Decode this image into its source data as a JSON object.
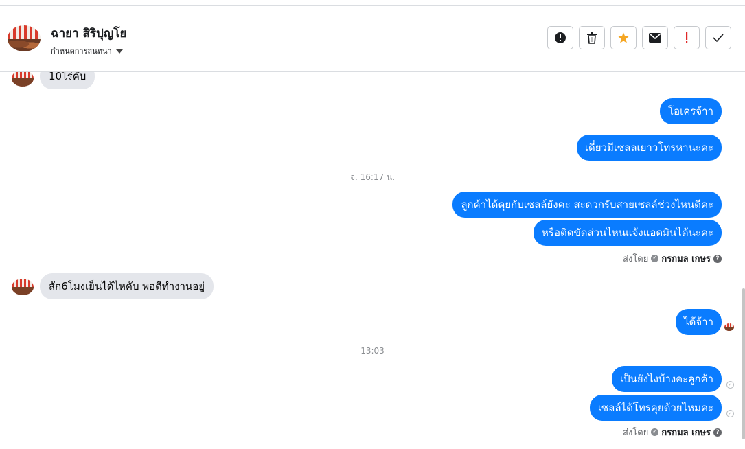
{
  "header": {
    "contact_name": "ฉายา สิริปุญโย",
    "conversation_settings": "กำหนดการสนทนา"
  },
  "toolbar": {
    "buttons": [
      {
        "icon": "alert-circle-icon",
        "label": "Info"
      },
      {
        "icon": "trash-icon",
        "label": "Delete"
      },
      {
        "icon": "star-icon",
        "label": "Star",
        "color": "#f5a623"
      },
      {
        "icon": "envelope-icon",
        "label": "Mark unread"
      },
      {
        "icon": "exclamation-icon",
        "label": "Spam",
        "color": "#e02828"
      },
      {
        "icon": "checkmark-icon",
        "label": "Done"
      }
    ]
  },
  "messages": {
    "m1_in": "10ไร่คับ",
    "m2_out": "โอเครจ้าา",
    "m3_out": "เดี๋ยวมีเซลลเยาวโทรหานะคะ",
    "ts1": "จ. 16:17 น.",
    "m4_out": "ลูกค้าได้คุยกับเซลล์ยังคะ สะดวกรับสายเซลล์ช่วงไหนดีคะ",
    "m5_out": "หรือติดขัดส่วนไหนแจ้งแอดมินได้นะคะ",
    "sent_by_label": "ส่งโดย",
    "sent_by_name": "กรกมล เกษร",
    "m6_in": "สัก6โมงเย็นได้ไหคับ พอดีทำงานอยู่",
    "m7_out": "ได้จ้าา",
    "ts2": "13:03",
    "m8_out": "เป็นยังไงบ้างคะลูกค้า",
    "m9_out": "เซลล์ได้โทรคุยด้วยไหมคะ",
    "sent_by_label_2": "ส่งโดย",
    "sent_by_name_2": "กรกมล เกษร"
  },
  "colors": {
    "outgoing_bubble": "#0a7cff",
    "incoming_bubble": "#e4e6eb",
    "star": "#f5a623",
    "spam": "#e02828"
  }
}
